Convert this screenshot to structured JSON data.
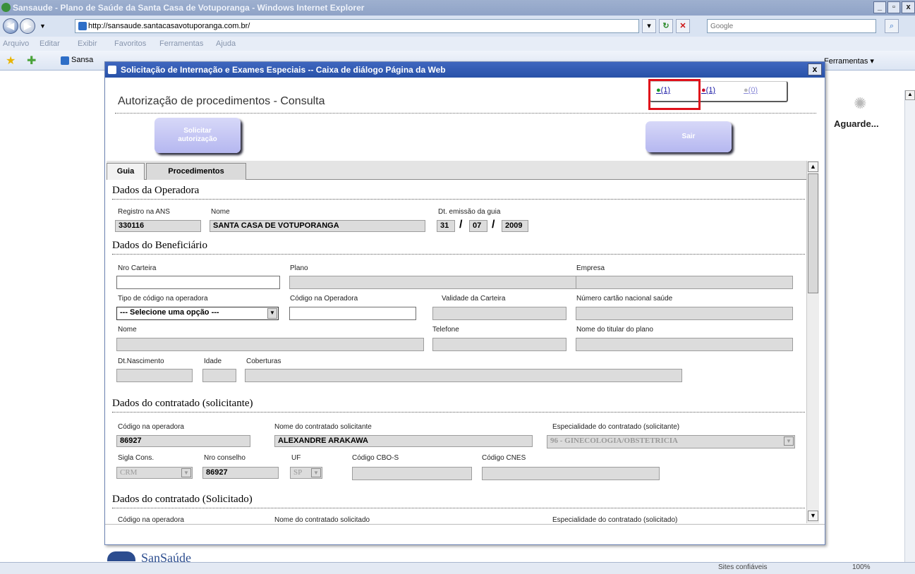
{
  "browser": {
    "window_title": "Sansaude - Plano de Saúde da Santa Casa de Votuporanga - Windows Internet Explorer",
    "url": "http://sansaude.santacasavotuporanga.com.br/",
    "search_placeholder": "Google",
    "menu": [
      "Arquivo",
      "Editar",
      "Exibir",
      "Favoritos",
      "Ferramentas",
      "Ajuda"
    ],
    "tab_label": "Sansa",
    "tools_label": "Ferramentas ▾",
    "waiting_text": "Aguarde...",
    "status_trusted": "Sites confiáveis",
    "zoom": "100%"
  },
  "dialog": {
    "title": "Solicitação de Internação e Exames Especiais -- Caixa de diálogo Página da Web",
    "close": "x",
    "heading": "Autorização de procedimentos - Consulta",
    "indicators": [
      {
        "label": "(1)",
        "color": "#1d9a2a"
      },
      {
        "label": "(1)",
        "color": "#c8102e"
      },
      {
        "label": "(0)",
        "color": "#b9b9b9"
      }
    ],
    "buttons": {
      "request_line1": "Solicitar",
      "request_line2": "autorização",
      "exit": "Sair"
    },
    "tabs": [
      "Guia",
      "Procedimentos"
    ]
  },
  "operadora": {
    "section": "Dados da Operadora",
    "ans_label": "Registro na ANS",
    "ans_value": "330116",
    "nome_label": "Nome",
    "nome_value": "SANTA CASA DE VOTUPORANGA",
    "emissao_label": "Dt. emissão da guia",
    "day": "31",
    "month": "07",
    "year": "2009",
    "sep": "/"
  },
  "beneficiario": {
    "section": "Dados do Beneficiário",
    "carteira_label": "Nro Carteira",
    "plano_label": "Plano",
    "empresa_label": "Empresa",
    "tipo_codigo_label": "Tipo de código na operadora",
    "tipo_codigo_value": "--- Selecione uma opção ---",
    "codigo_operadora_label": "Código na Operadora",
    "validade_label": "Validade da Carteira",
    "cns_label": "Número cartão nacional saúde",
    "nome_label": "Nome",
    "telefone_label": "Telefone",
    "titular_label": "Nome do titular do plano",
    "nascimento_label": "Dt.Nascimento",
    "idade_label": "Idade",
    "coberturas_label": "Coberturas"
  },
  "solicitante": {
    "section": "Dados do contratado (solicitante)",
    "codigo_label": "Código na operadora",
    "codigo_value": "86927",
    "nome_label": "Nome do contratado solicitante",
    "nome_value": "ALEXANDRE ARAKAWA",
    "especialidade_label": "Especialidade do contratado (solicitante)",
    "especialidade_value": "96 - GINECOLOGIA/OBSTETRICIA",
    "sigla_label": "Sigla Cons.",
    "sigla_value": "CRM",
    "conselho_label": "Nro conselho",
    "conselho_value": "86927",
    "uf_label": "UF",
    "uf_value": "SP",
    "cbo_label": "Código CBO-S",
    "cnes_label": "Código CNES"
  },
  "solicitado": {
    "section": "Dados do contratado (Solicitado)",
    "codigo_label": "Código na operadora",
    "nome_label": "Nome do contratado solicitado",
    "especialidade_label": "Especialidade do contratado (solicitado)"
  },
  "footer_logo": "SanSaúde"
}
